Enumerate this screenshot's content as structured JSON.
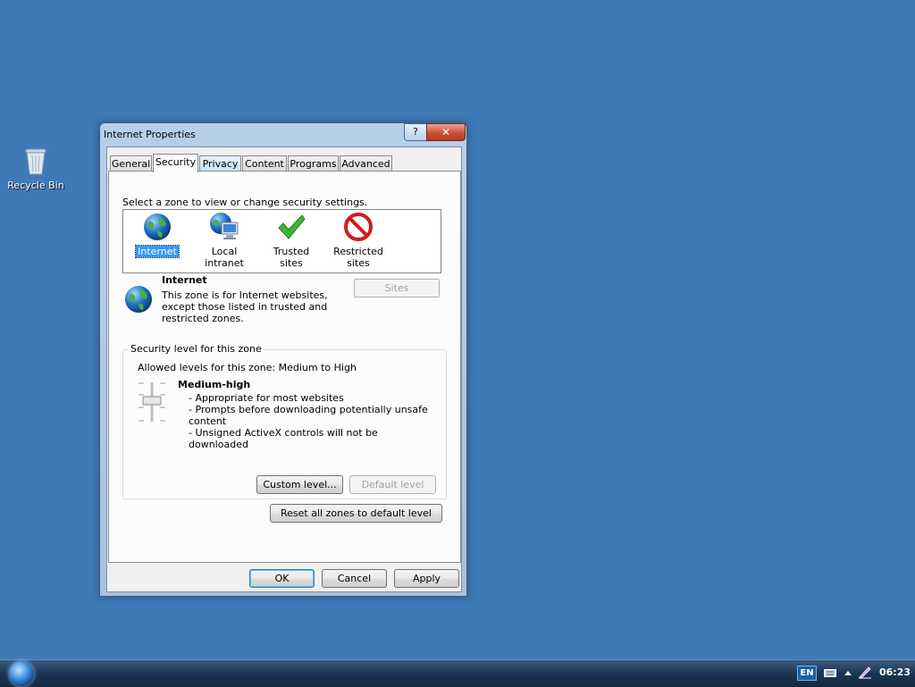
{
  "desktop": {
    "recycle_bin_label": "Recycle Bin"
  },
  "window": {
    "title": "Internet Properties",
    "help_label": "?",
    "close_label": "✕"
  },
  "tabs": [
    {
      "label": "General"
    },
    {
      "label": "Security"
    },
    {
      "label": "Privacy"
    },
    {
      "label": "Content"
    },
    {
      "label": "Programs"
    },
    {
      "label": "Advanced"
    }
  ],
  "security": {
    "zone_caption": "Select a zone to view or change security settings.",
    "zones": [
      {
        "label": "Internet"
      },
      {
        "label": "Local intranet"
      },
      {
        "label": "Trusted sites"
      },
      {
        "label": "Restricted sites"
      }
    ],
    "zone_name": "Internet",
    "zone_description": "This zone is for Internet websites, except those listed in trusted and restricted zones.",
    "sites_button": "Sites",
    "group_title": "Security level for this zone",
    "allowed_levels": "Allowed levels for this zone: Medium to High",
    "level_name": "Medium-high",
    "level_notes": [
      "- Appropriate for most websites",
      "- Prompts before downloading potentially unsafe content",
      "- Unsigned ActiveX controls will not be downloaded"
    ],
    "custom_level_button": "Custom level...",
    "default_level_button": "Default level",
    "reset_all_button": "Reset all zones to default level"
  },
  "footer": {
    "ok": "OK",
    "cancel": "Cancel",
    "apply": "Apply"
  },
  "taskbar": {
    "language": "EN",
    "clock": "06:23"
  }
}
